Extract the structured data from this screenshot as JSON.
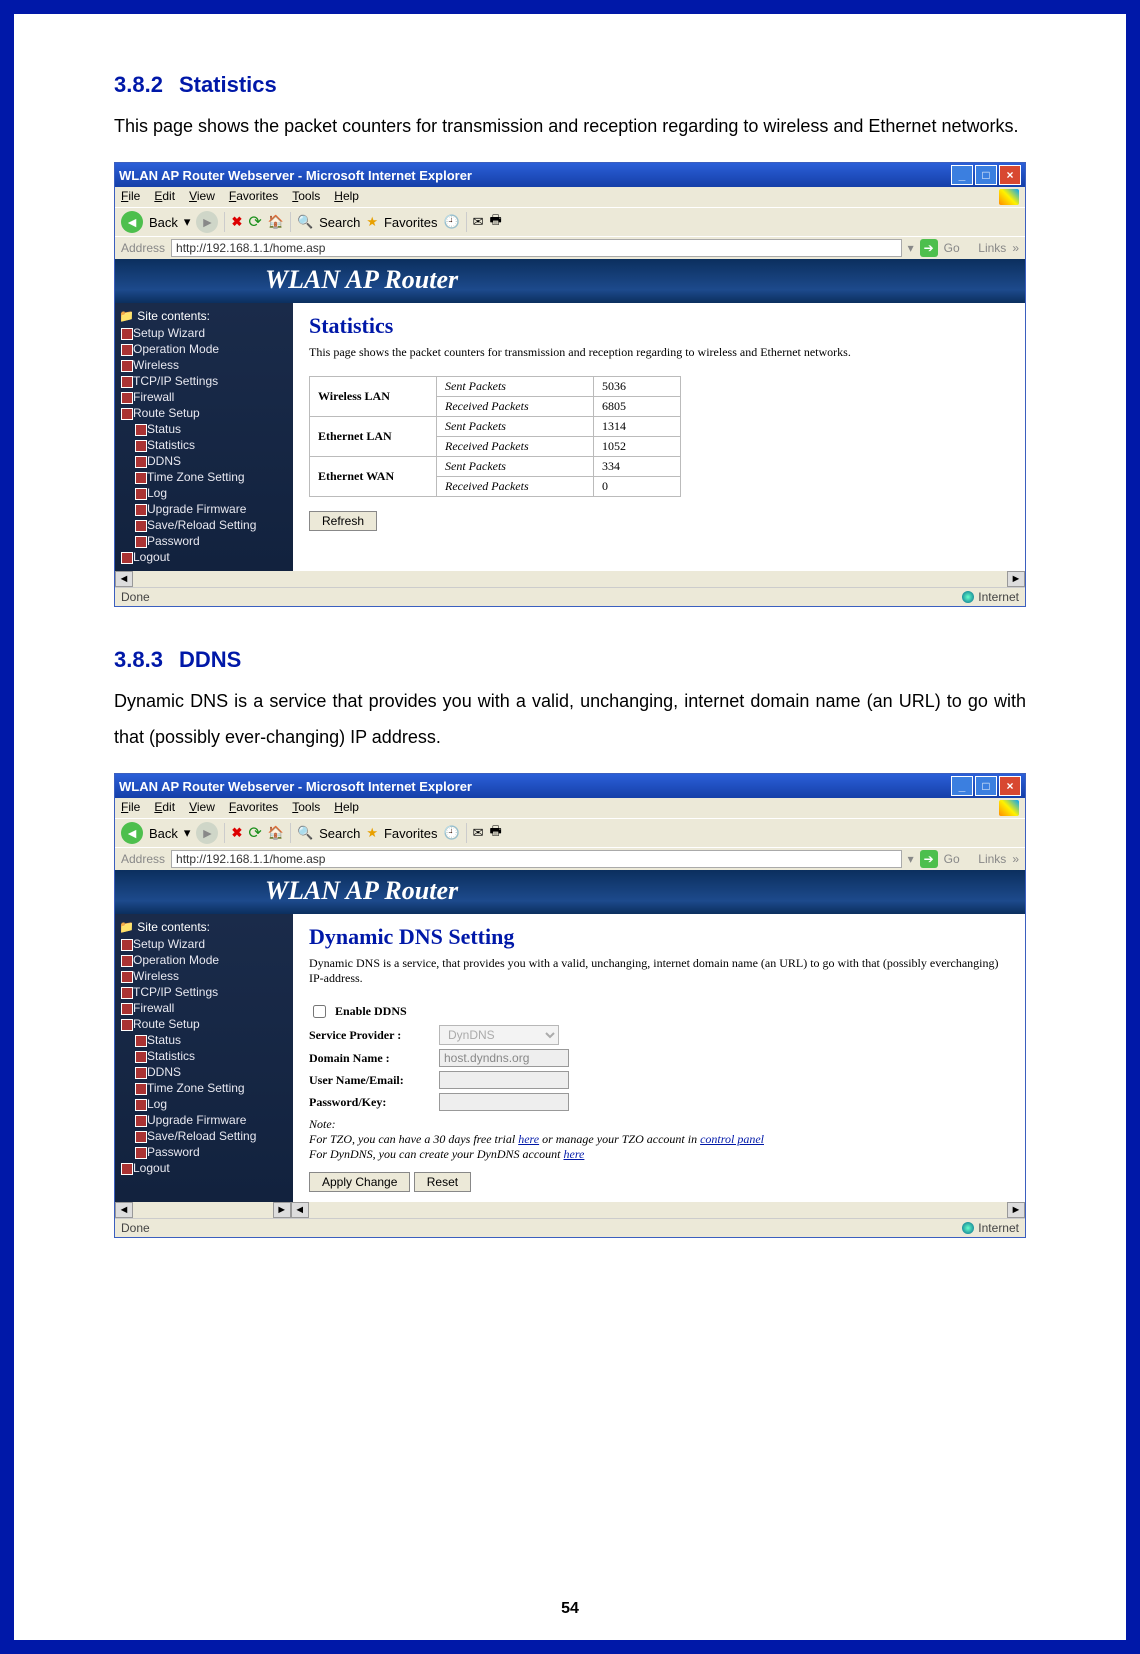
{
  "page_number": "54",
  "sec1": {
    "num": "3.8.2",
    "title": "Statistics",
    "text": "This page shows the packet counters for transmission and reception regarding to wireless and Ethernet networks."
  },
  "sec2": {
    "num": "3.8.3",
    "title": "DDNS",
    "text": "Dynamic DNS is a service that provides you with a valid, unchanging, internet domain name (an URL) to go with that (possibly ever-changing) IP address."
  },
  "browser": {
    "title": "WLAN AP Router Webserver - Microsoft Internet Explorer",
    "menu": {
      "file": "File",
      "edit": "Edit",
      "view": "View",
      "favorites": "Favorites",
      "tools": "Tools",
      "help": "Help"
    },
    "toolbar": {
      "back": "Back",
      "search": "Search",
      "favorites": "Favorites"
    },
    "addr_label": "Address",
    "url": "http://192.168.1.1/home.asp",
    "go": "Go",
    "links": "Links",
    "status_done": "Done",
    "status_internet": "Internet"
  },
  "router_banner": "WLAN AP Router",
  "sidebar": {
    "title": "Site contents:",
    "items": [
      "Setup Wizard",
      "Operation Mode",
      "Wireless",
      "TCP/IP Settings",
      "Firewall",
      "Route Setup"
    ],
    "sub": [
      "Status",
      "Statistics",
      "DDNS",
      "Time Zone Setting",
      "Log",
      "Upgrade Firmware",
      "Save/Reload Setting",
      "Password"
    ],
    "last": "Logout"
  },
  "stats_page": {
    "heading": "Statistics",
    "desc": "This page shows the packet counters for transmission and reception regarding to wireless and Ethernet networks.",
    "rows": [
      {
        "iface": "Wireless LAN",
        "sent": "Sent Packets",
        "sval": "5036",
        "recv": "Received Packets",
        "rval": "6805"
      },
      {
        "iface": "Ethernet LAN",
        "sent": "Sent Packets",
        "sval": "1314",
        "recv": "Received Packets",
        "rval": "1052"
      },
      {
        "iface": "Ethernet WAN",
        "sent": "Sent Packets",
        "sval": "334",
        "recv": "Received Packets",
        "rval": "0"
      }
    ],
    "refresh": "Refresh"
  },
  "ddns_page": {
    "heading": "Dynamic DNS  Setting",
    "desc": "Dynamic DNS is a service, that provides you with a valid, unchanging, internet domain name (an URL) to go with that (possibly everchanging) IP-address.",
    "enable": "Enable DDNS",
    "provider_lbl": "Service Provider :",
    "provider_val": "DynDNS",
    "domain_lbl": "Domain Name :",
    "domain_val": "host.dyndns.org",
    "user_lbl": "User Name/Email:",
    "pass_lbl": "Password/Key:",
    "note_label": "Note:",
    "note1a": "For TZO, you can have a 30 days free trial ",
    "here": "here",
    "note1b": " or manage your TZO account in ",
    "ctrl": "control panel",
    "note2": "For DynDNS, you can create your DynDNS account ",
    "apply": "Apply Change",
    "reset": "Reset"
  }
}
